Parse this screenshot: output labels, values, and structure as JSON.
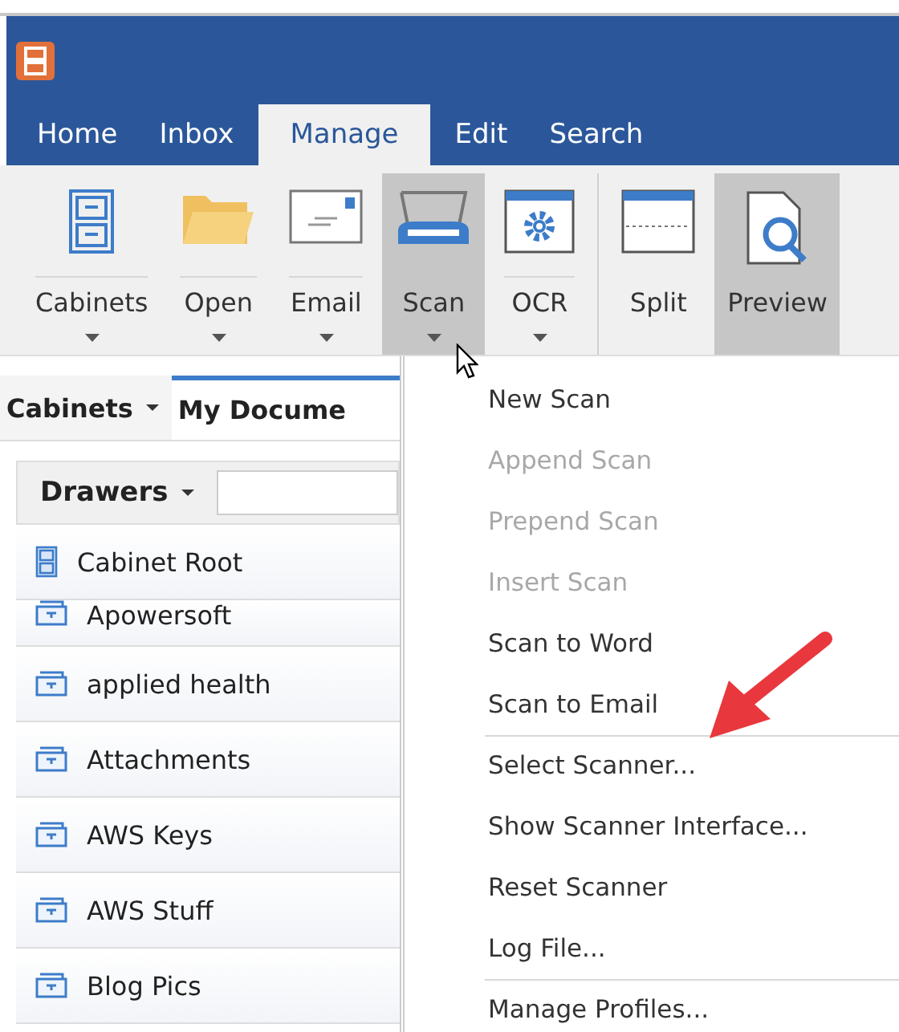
{
  "tabs": [
    {
      "label": "Home",
      "selected": false
    },
    {
      "label": "Inbox",
      "selected": false
    },
    {
      "label": "Manage",
      "selected": true
    },
    {
      "label": "Edit",
      "selected": false
    },
    {
      "label": "Search",
      "selected": false
    }
  ],
  "ribbon": [
    {
      "label": "Cabinets",
      "dropdown": true,
      "pressed": false
    },
    {
      "label": "Open",
      "dropdown": true,
      "pressed": false
    },
    {
      "label": "Email",
      "dropdown": true,
      "pressed": false
    },
    {
      "label": "Scan",
      "dropdown": true,
      "pressed": true
    },
    {
      "label": "OCR",
      "dropdown": true,
      "pressed": false
    },
    {
      "label": "Split",
      "dropdown": false,
      "pressed": false
    },
    {
      "label": "Preview",
      "dropdown": false,
      "pressed": true
    }
  ],
  "panel_tabs": [
    {
      "label": "Cabinets",
      "selected": false
    },
    {
      "label": "My Docume",
      "selected": true
    }
  ],
  "drawers": {
    "label": "Drawers",
    "items": [
      {
        "label": "Cabinet Root",
        "kind": "root"
      },
      {
        "label": "Apowersoft",
        "kind": "drawer"
      },
      {
        "label": "applied health",
        "kind": "drawer"
      },
      {
        "label": "Attachments",
        "kind": "drawer"
      },
      {
        "label": "AWS Keys",
        "kind": "drawer"
      },
      {
        "label": "AWS Stuff",
        "kind": "drawer"
      },
      {
        "label": "Blog Pics",
        "kind": "drawer"
      }
    ]
  },
  "scan_menu": [
    {
      "label": "New Scan",
      "disabled": false,
      "separator_before": false
    },
    {
      "label": "Append Scan",
      "disabled": true,
      "separator_before": false
    },
    {
      "label": "Prepend Scan",
      "disabled": true,
      "separator_before": false
    },
    {
      "label": "Insert Scan",
      "disabled": true,
      "separator_before": false
    },
    {
      "label": "Scan to Word",
      "disabled": false,
      "separator_before": false
    },
    {
      "label": "Scan to Email",
      "disabled": false,
      "separator_before": false
    },
    {
      "label": "Select Scanner...",
      "disabled": false,
      "separator_before": true
    },
    {
      "label": "Show Scanner Interface...",
      "disabled": false,
      "separator_before": false
    },
    {
      "label": "Reset Scanner",
      "disabled": false,
      "separator_before": false
    },
    {
      "label": "Log File...",
      "disabled": false,
      "separator_before": false
    },
    {
      "label": "Manage Profiles...",
      "disabled": false,
      "separator_before": true
    }
  ]
}
